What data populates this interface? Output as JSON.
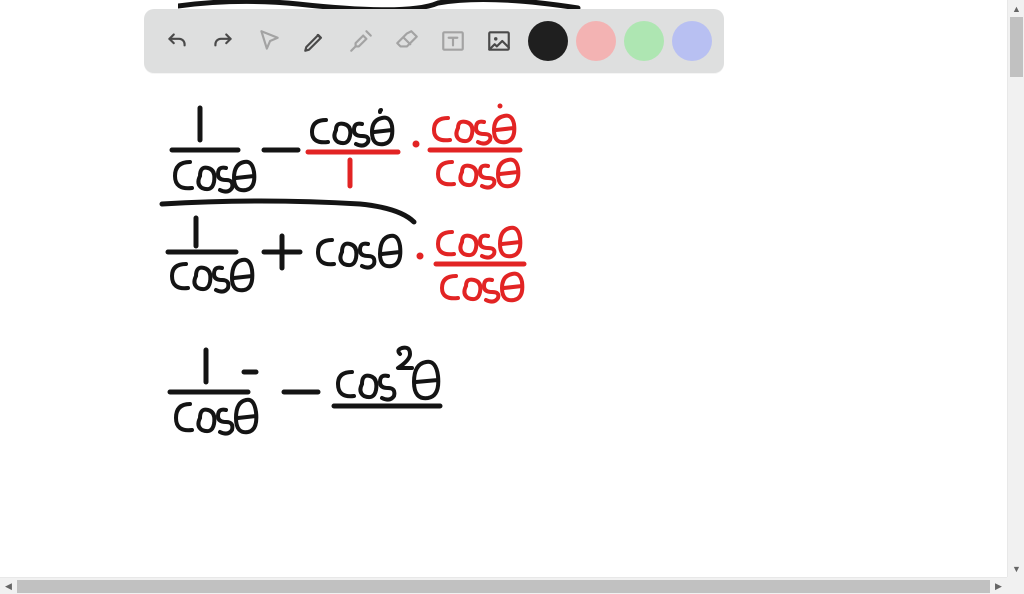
{
  "toolbar": {
    "tools": [
      {
        "name": "undo",
        "enabled": true
      },
      {
        "name": "redo",
        "enabled": true
      },
      {
        "name": "pointer",
        "enabled": false
      },
      {
        "name": "pen",
        "enabled": true
      },
      {
        "name": "tools-gear",
        "enabled": false
      },
      {
        "name": "eraser",
        "enabled": false
      },
      {
        "name": "text-box",
        "enabled": false
      },
      {
        "name": "image",
        "enabled": true
      }
    ],
    "colors": [
      {
        "name": "black",
        "hex": "#1f1f1f",
        "selected": true
      },
      {
        "name": "red",
        "hex": "#f3b3b3",
        "selected": false
      },
      {
        "name": "green",
        "hex": "#aee6b2",
        "selected": false
      },
      {
        "name": "blue",
        "hex": "#b8c0f2",
        "selected": false
      }
    ]
  },
  "handwriting": {
    "description": "Trigonometric identity work in black and red ink",
    "lines": [
      "1/cosθ − cosθ/1 · cosθ/cosθ",
      "────────────────────────",
      "1/cosθ + cosθ · cosθ/cosθ",
      "",
      "1/cosθ − cos²θ"
    ],
    "colors": {
      "black": "#141414",
      "red": "#e22424"
    }
  }
}
